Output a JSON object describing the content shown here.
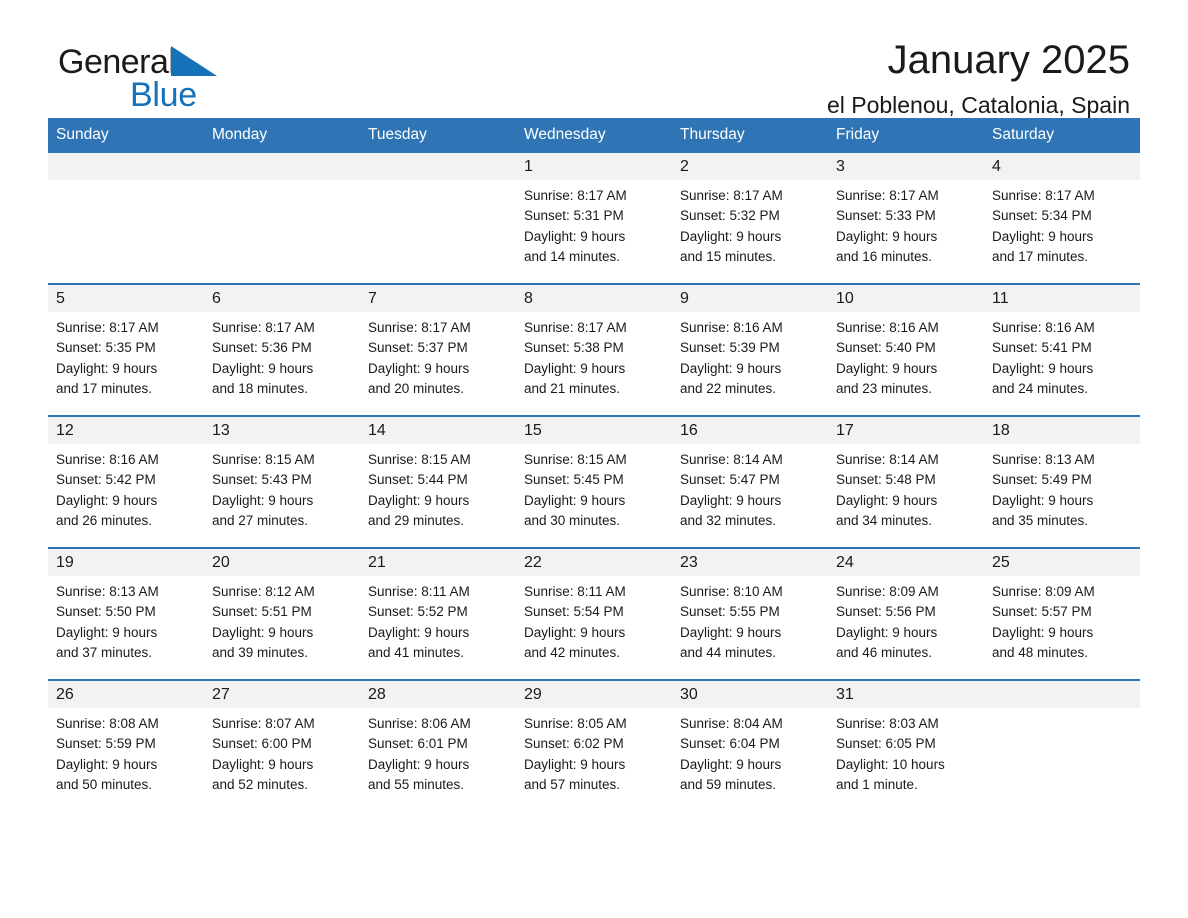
{
  "brand": {
    "name_top": "General",
    "name_bottom": "Blue",
    "logo_icon": "triangle-icon",
    "accent_color": "#1672b8"
  },
  "header": {
    "month_title": "January 2025",
    "location": "el Poblenou, Catalonia, Spain"
  },
  "theme": {
    "header_blue": "#2f75b5",
    "row_band_gray": "#f2f2f2",
    "text_black": "#1a1a1a"
  },
  "calendar": {
    "weekday_headers": [
      "Sunday",
      "Monday",
      "Tuesday",
      "Wednesday",
      "Thursday",
      "Friday",
      "Saturday"
    ],
    "weeks": [
      [
        {
          "day": "",
          "blank": true,
          "lines": []
        },
        {
          "day": "",
          "blank": true,
          "lines": []
        },
        {
          "day": "",
          "blank": true,
          "lines": []
        },
        {
          "day": "1",
          "lines": [
            "Sunrise: 8:17 AM",
            "Sunset: 5:31 PM",
            "Daylight: 9 hours",
            "and 14 minutes."
          ]
        },
        {
          "day": "2",
          "lines": [
            "Sunrise: 8:17 AM",
            "Sunset: 5:32 PM",
            "Daylight: 9 hours",
            "and 15 minutes."
          ]
        },
        {
          "day": "3",
          "lines": [
            "Sunrise: 8:17 AM",
            "Sunset: 5:33 PM",
            "Daylight: 9 hours",
            "and 16 minutes."
          ]
        },
        {
          "day": "4",
          "lines": [
            "Sunrise: 8:17 AM",
            "Sunset: 5:34 PM",
            "Daylight: 9 hours",
            "and 17 minutes."
          ]
        }
      ],
      [
        {
          "day": "5",
          "lines": [
            "Sunrise: 8:17 AM",
            "Sunset: 5:35 PM",
            "Daylight: 9 hours",
            "and 17 minutes."
          ]
        },
        {
          "day": "6",
          "lines": [
            "Sunrise: 8:17 AM",
            "Sunset: 5:36 PM",
            "Daylight: 9 hours",
            "and 18 minutes."
          ]
        },
        {
          "day": "7",
          "lines": [
            "Sunrise: 8:17 AM",
            "Sunset: 5:37 PM",
            "Daylight: 9 hours",
            "and 20 minutes."
          ]
        },
        {
          "day": "8",
          "lines": [
            "Sunrise: 8:17 AM",
            "Sunset: 5:38 PM",
            "Daylight: 9 hours",
            "and 21 minutes."
          ]
        },
        {
          "day": "9",
          "lines": [
            "Sunrise: 8:16 AM",
            "Sunset: 5:39 PM",
            "Daylight: 9 hours",
            "and 22 minutes."
          ]
        },
        {
          "day": "10",
          "lines": [
            "Sunrise: 8:16 AM",
            "Sunset: 5:40 PM",
            "Daylight: 9 hours",
            "and 23 minutes."
          ]
        },
        {
          "day": "11",
          "lines": [
            "Sunrise: 8:16 AM",
            "Sunset: 5:41 PM",
            "Daylight: 9 hours",
            "and 24 minutes."
          ]
        }
      ],
      [
        {
          "day": "12",
          "lines": [
            "Sunrise: 8:16 AM",
            "Sunset: 5:42 PM",
            "Daylight: 9 hours",
            "and 26 minutes."
          ]
        },
        {
          "day": "13",
          "lines": [
            "Sunrise: 8:15 AM",
            "Sunset: 5:43 PM",
            "Daylight: 9 hours",
            "and 27 minutes."
          ]
        },
        {
          "day": "14",
          "lines": [
            "Sunrise: 8:15 AM",
            "Sunset: 5:44 PM",
            "Daylight: 9 hours",
            "and 29 minutes."
          ]
        },
        {
          "day": "15",
          "lines": [
            "Sunrise: 8:15 AM",
            "Sunset: 5:45 PM",
            "Daylight: 9 hours",
            "and 30 minutes."
          ]
        },
        {
          "day": "16",
          "lines": [
            "Sunrise: 8:14 AM",
            "Sunset: 5:47 PM",
            "Daylight: 9 hours",
            "and 32 minutes."
          ]
        },
        {
          "day": "17",
          "lines": [
            "Sunrise: 8:14 AM",
            "Sunset: 5:48 PM",
            "Daylight: 9 hours",
            "and 34 minutes."
          ]
        },
        {
          "day": "18",
          "lines": [
            "Sunrise: 8:13 AM",
            "Sunset: 5:49 PM",
            "Daylight: 9 hours",
            "and 35 minutes."
          ]
        }
      ],
      [
        {
          "day": "19",
          "lines": [
            "Sunrise: 8:13 AM",
            "Sunset: 5:50 PM",
            "Daylight: 9 hours",
            "and 37 minutes."
          ]
        },
        {
          "day": "20",
          "lines": [
            "Sunrise: 8:12 AM",
            "Sunset: 5:51 PM",
            "Daylight: 9 hours",
            "and 39 minutes."
          ]
        },
        {
          "day": "21",
          "lines": [
            "Sunrise: 8:11 AM",
            "Sunset: 5:52 PM",
            "Daylight: 9 hours",
            "and 41 minutes."
          ]
        },
        {
          "day": "22",
          "lines": [
            "Sunrise: 8:11 AM",
            "Sunset: 5:54 PM",
            "Daylight: 9 hours",
            "and 42 minutes."
          ]
        },
        {
          "day": "23",
          "lines": [
            "Sunrise: 8:10 AM",
            "Sunset: 5:55 PM",
            "Daylight: 9 hours",
            "and 44 minutes."
          ]
        },
        {
          "day": "24",
          "lines": [
            "Sunrise: 8:09 AM",
            "Sunset: 5:56 PM",
            "Daylight: 9 hours",
            "and 46 minutes."
          ]
        },
        {
          "day": "25",
          "lines": [
            "Sunrise: 8:09 AM",
            "Sunset: 5:57 PM",
            "Daylight: 9 hours",
            "and 48 minutes."
          ]
        }
      ],
      [
        {
          "day": "26",
          "lines": [
            "Sunrise: 8:08 AM",
            "Sunset: 5:59 PM",
            "Daylight: 9 hours",
            "and 50 minutes."
          ]
        },
        {
          "day": "27",
          "lines": [
            "Sunrise: 8:07 AM",
            "Sunset: 6:00 PM",
            "Daylight: 9 hours",
            "and 52 minutes."
          ]
        },
        {
          "day": "28",
          "lines": [
            "Sunrise: 8:06 AM",
            "Sunset: 6:01 PM",
            "Daylight: 9 hours",
            "and 55 minutes."
          ]
        },
        {
          "day": "29",
          "lines": [
            "Sunrise: 8:05 AM",
            "Sunset: 6:02 PM",
            "Daylight: 9 hours",
            "and 57 minutes."
          ]
        },
        {
          "day": "30",
          "lines": [
            "Sunrise: 8:04 AM",
            "Sunset: 6:04 PM",
            "Daylight: 9 hours",
            "and 59 minutes."
          ]
        },
        {
          "day": "31",
          "lines": [
            "Sunrise: 8:03 AM",
            "Sunset: 6:05 PM",
            "Daylight: 10 hours",
            "and 1 minute."
          ]
        },
        {
          "day": "",
          "blank": true,
          "lines": []
        }
      ]
    ]
  }
}
